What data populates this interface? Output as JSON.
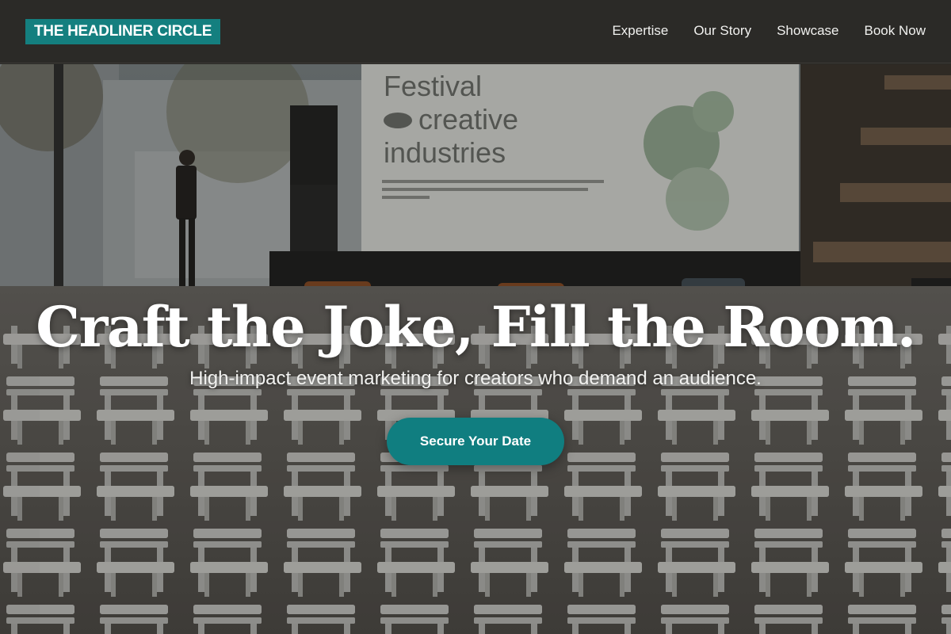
{
  "brand": {
    "name": "THE HEADLINER CIRCLE"
  },
  "nav": {
    "items": [
      {
        "label": "Expertise"
      },
      {
        "label": "Our Story"
      },
      {
        "label": "Showcase"
      },
      {
        "label": "Book Now"
      }
    ]
  },
  "hero": {
    "title": "Craft the Joke, Fill the Room.",
    "subtitle": "High-impact event marketing for creators who demand an audience.",
    "cta_label": "Secure Your Date",
    "background_photo": {
      "screen_title_line1": "Festival",
      "screen_title_line2": "creative",
      "screen_title_line3": "industries"
    }
  },
  "colors": {
    "accent": "#147f7f",
    "header_bg": "#2b2a27",
    "text_light": "#ffffff"
  }
}
